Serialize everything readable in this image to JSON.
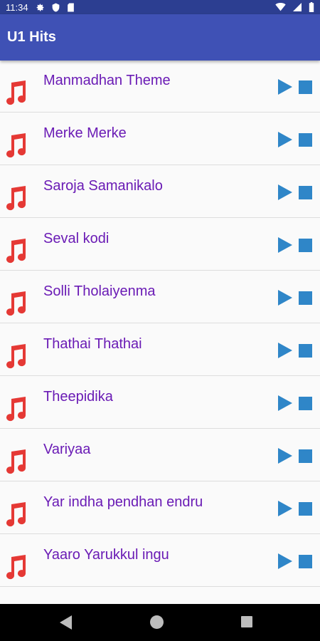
{
  "status_bar": {
    "time": "11:34",
    "icons": [
      "gear-icon",
      "shield-icon",
      "sd-card-icon",
      "wifi-icon",
      "signal-icon",
      "battery-icon"
    ]
  },
  "app_bar": {
    "title": "U1 Hits"
  },
  "colors": {
    "app_bar": "#3f51b5",
    "status_bar": "#2c3e91",
    "song_title": "#6a1bb5",
    "note_icon": "#e53935",
    "play_stop": "#2f86c8"
  },
  "songs": [
    {
      "title": ""
    },
    {
      "title": "Manmadhan Theme"
    },
    {
      "title": "Merke Merke"
    },
    {
      "title": "Saroja Samanikalo"
    },
    {
      "title": "Seval kodi"
    },
    {
      "title": "Solli Tholaiyenma"
    },
    {
      "title": "Thathai Thathai"
    },
    {
      "title": "Theepidika"
    },
    {
      "title": "Variyaa"
    },
    {
      "title": "Yar indha pendhan endru"
    },
    {
      "title": "Yaaro Yarukkul ingu"
    }
  ],
  "nav_bar": {
    "icons": [
      "back-icon",
      "home-icon",
      "recents-icon"
    ]
  }
}
